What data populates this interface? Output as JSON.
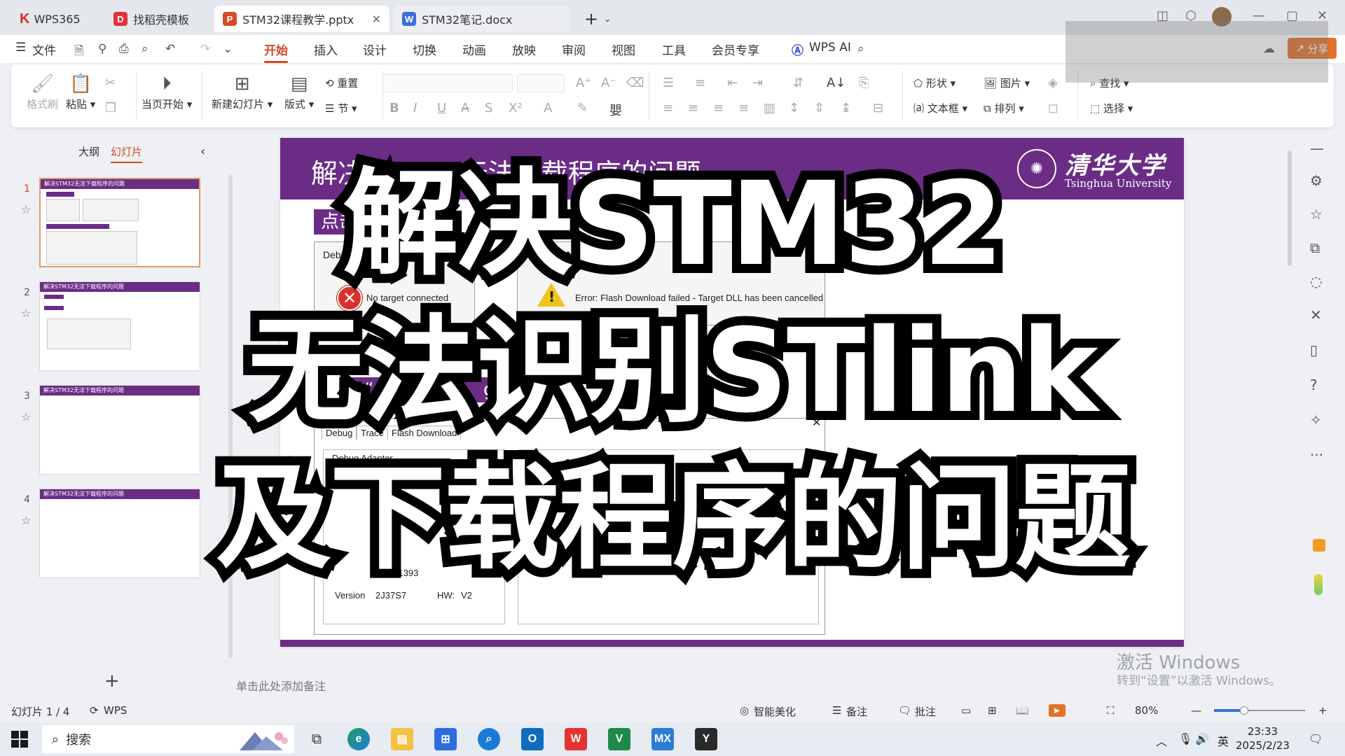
{
  "tabs": {
    "home": "WPS365",
    "template": "找稻壳模板",
    "pptx": "STM32课程教学.pptx",
    "docx": "STM32笔记.docx",
    "new_tab": "+"
  },
  "menu": {
    "file": "文件",
    "items": [
      "开始",
      "插入",
      "设计",
      "切换",
      "动画",
      "放映",
      "审阅",
      "视图",
      "工具",
      "会员专享"
    ],
    "wps_ai": "WPS AI",
    "share": "分享"
  },
  "ribbon": {
    "format_painter": "格式刷",
    "paste": "粘贴",
    "from_current": "当页开始",
    "new_slide": "新建幻灯片",
    "layout": "版式",
    "reset": "重置",
    "section": "节",
    "shape": "形状",
    "picture": "图片",
    "find": "查找",
    "textbox": "文本框",
    "arrange": "排列",
    "select": "选择"
  },
  "left_panel": {
    "outline_tab": "大纲",
    "slides_tab": "幻灯片",
    "thumb_title": "解决STM32无法下载程序的问题",
    "slide_numbers": [
      "1",
      "2",
      "3",
      "4"
    ]
  },
  "slide": {
    "title": "解决STM32无法下载程序的问题",
    "logo_cn": "清华大学",
    "logo_en": "Tsinghua University",
    "step1": "点击“",
    "step2": "击“Opti",
    "step2_b": "ge",
    "debugger_label": "Debugger",
    "error1": "No target connected",
    "error2": "Error: Flash Download failed  -  Target DLL has been cancelled",
    "dlg_tabs": [
      "Debug",
      "Trace",
      "Flash Download"
    ],
    "debug_adapter": "Debug Adapter",
    "serial": "0D0D21393",
    "version_label": "Version",
    "version_value": "2J37S7",
    "hw_label": "HW:",
    "hw_value": "V2"
  },
  "caption": {
    "line1": "解决STM32",
    "line2": "无法识别STlink",
    "line3": "及下载程序的问题"
  },
  "notes": {
    "placeholder": "单击此处添加备注"
  },
  "watermark": {
    "line1": "激活 Windows",
    "line2": "转到“设置”以激活 Windows。"
  },
  "status": {
    "slide_counter": "幻灯片 1 / 4",
    "app": "WPS",
    "beautify": "智能美化",
    "notes": "备注",
    "comments": "批注",
    "zoom": "80%",
    "zoom_fraction": 0.33
  },
  "taskbar": {
    "search": "搜索",
    "ime": "英",
    "time": "23:33",
    "date": "2025/2/23"
  },
  "colors": {
    "accent": "#d04a24",
    "purple": "#6b2c86",
    "share": "#e2712a"
  }
}
